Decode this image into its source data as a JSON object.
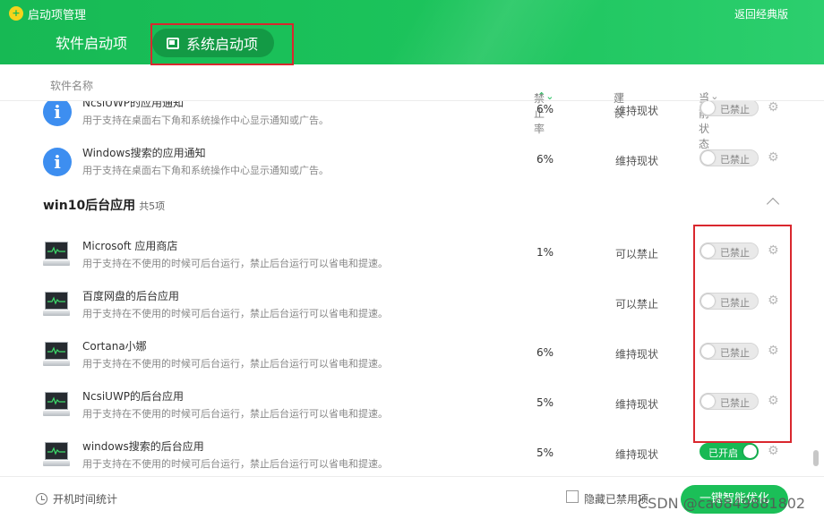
{
  "window": {
    "title": "启动项管理",
    "back_classic": "返回经典版"
  },
  "tabs": [
    {
      "label": "软件启动项",
      "icon": "grid-icon"
    },
    {
      "label": "系统启动项",
      "icon": "system-icon",
      "active": true
    }
  ],
  "columns": {
    "name": "软件名称",
    "rate": "禁止率",
    "suggestion": "建议",
    "state": "当前状态"
  },
  "top_rows": [
    {
      "name": "NcsiUWP的应用通知",
      "desc": "用于支持在桌面右下角和系统操作中心显示通知或广告。",
      "rate": "6%",
      "suggestion": "维持现状",
      "state": "已禁止",
      "on": false,
      "icon": "info-icon"
    },
    {
      "name": "Windows搜索的应用通知",
      "desc": "用于支持在桌面右下角和系统操作中心显示通知或广告。",
      "rate": "6%",
      "suggestion": "维持现状",
      "state": "已禁止",
      "on": false,
      "icon": "info-icon"
    }
  ],
  "group": {
    "title": "win10后台应用",
    "count": "共5项"
  },
  "group_rows": [
    {
      "name": "Microsoft 应用商店",
      "desc": "用于支持在不使用的时候可后台运行，禁止后台运行可以省电和提速。",
      "rate": "1%",
      "suggestion": "可以禁止",
      "state": "已禁止",
      "on": false,
      "icon": "monitor-icon"
    },
    {
      "name": "百度网盘的后台应用",
      "desc": "用于支持在不使用的时候可后台运行，禁止后台运行可以省电和提速。",
      "rate": "",
      "suggestion": "可以禁止",
      "state": "已禁止",
      "on": false,
      "icon": "monitor-icon"
    },
    {
      "name": "Cortana小娜",
      "desc": "用于支持在不使用的时候可后台运行，禁止后台运行可以省电和提速。",
      "rate": "6%",
      "suggestion": "维持现状",
      "state": "已禁止",
      "on": false,
      "icon": "monitor-icon"
    },
    {
      "name": "NcsiUWP的后台应用",
      "desc": "用于支持在不使用的时候可后台运行，禁止后台运行可以省电和提速。",
      "rate": "5%",
      "suggestion": "维持现状",
      "state": "已禁止",
      "on": false,
      "icon": "monitor-icon"
    },
    {
      "name": "windows搜索的后台应用",
      "desc": "用于支持在不使用的时候可后台运行，禁止后台运行可以省电和提速。",
      "rate": "5%",
      "suggestion": "维持现状",
      "state": "已开启",
      "on": true,
      "icon": "monitor-icon"
    }
  ],
  "footer": {
    "boot_stats": "开机时间统计",
    "hide_disabled": "隐藏已禁用项",
    "optimize": "一键智能优化"
  },
  "watermark": "CSDN @ca0849881802",
  "colors": {
    "accent": "#17b954",
    "tab_active_bg": "#139a45",
    "highlight_box": "#d9272e"
  }
}
